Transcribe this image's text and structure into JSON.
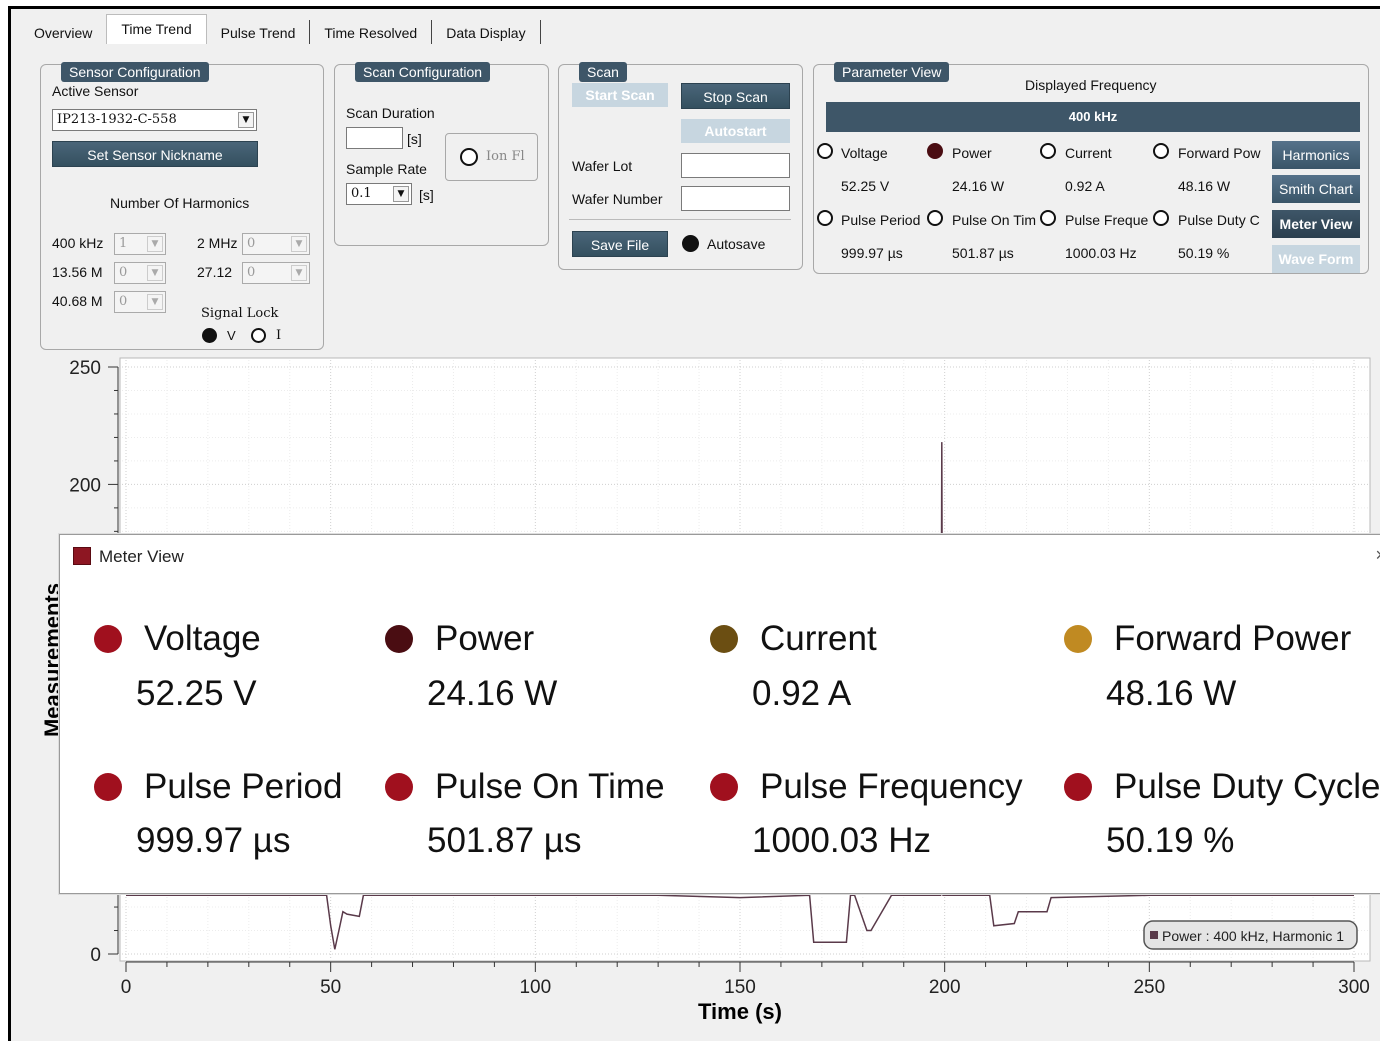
{
  "tabs": [
    "Overview",
    "Time Trend",
    "Pulse Trend",
    "Time Resolved",
    "Data Display"
  ],
  "sensor_config": {
    "title": "Sensor Configuration",
    "active_sensor_label": "Active Sensor",
    "active_sensor_value": "IP213-1932-C-558",
    "nickname_button": "Set Sensor Nickname",
    "harmonics_label": "Number Of Harmonics",
    "harmonics": [
      {
        "freq": "400 kHz",
        "value": "1"
      },
      {
        "freq": "2 MHz",
        "value": "0"
      },
      {
        "freq": "13.56 M",
        "value": "0"
      },
      {
        "freq": "27.12",
        "value": "0"
      },
      {
        "freq": "40.68 M",
        "value": "0"
      }
    ],
    "signal_lock_label": "Signal Lock",
    "signal_lock_v": "V",
    "signal_lock_i": "I"
  },
  "scan_config": {
    "title": "Scan Configuration",
    "duration_label": "Scan Duration",
    "duration_value": "",
    "unit_s": "[s]",
    "sample_rate_label": "Sample Rate",
    "sample_rate_value": "0.1",
    "ion_flux_label": "Ion Fl"
  },
  "scan": {
    "title": "Scan",
    "start_button": "Start Scan",
    "stop_button": "Stop Scan",
    "autostart_button": "Autostart",
    "wafer_lot_label": "Wafer Lot",
    "wafer_lot_value": "",
    "wafer_number_label": "Wafer Number",
    "wafer_number_value": "",
    "save_button": "Save File",
    "autosave_label": "Autosave"
  },
  "parameter_view": {
    "title": "Parameter View",
    "displayed_frequency_label": "Displayed Frequency",
    "displayed_frequency": "400 kHz",
    "params_row1": [
      {
        "name": "Voltage",
        "value": "52.25 V",
        "selected": false
      },
      {
        "name": "Power",
        "value": "24.16 W",
        "selected": true
      },
      {
        "name": "Current",
        "value": "0.92 A",
        "selected": false
      },
      {
        "name": "Forward Pow",
        "value": "48.16 W",
        "selected": false
      }
    ],
    "params_row2": [
      {
        "name": "Pulse Period",
        "value": "999.97 µs",
        "selected": false
      },
      {
        "name": "Pulse On Tim",
        "value": "501.87 µs",
        "selected": false
      },
      {
        "name": "Pulse Freque",
        "value": "1000.03 Hz",
        "selected": false
      },
      {
        "name": "Pulse Duty C",
        "value": "50.19 %",
        "selected": false
      }
    ],
    "buttons": [
      "Harmonics",
      "Smith Chart",
      "Meter View",
      "Wave Form"
    ]
  },
  "chart_data": {
    "type": "line",
    "xlabel": "Time (s)",
    "ylabel": "Measurements",
    "x_ticks": [
      "0",
      "50",
      "100",
      "150",
      "200",
      "250",
      "300"
    ],
    "y_ticks": [
      "0",
      "200",
      "250"
    ],
    "xlim": [
      0,
      300
    ],
    "ylim": [
      0,
      250
    ],
    "grid": true,
    "legend": "Power : 400 kHz, Harmonic 1",
    "series": [
      {
        "name": "Power : 400 kHz, Harmonic 1",
        "x": [
          0,
          49,
          50,
          51,
          52,
          53,
          54,
          57,
          58,
          130,
          150,
          167,
          168,
          176,
          177,
          178,
          181,
          182,
          187,
          188,
          193,
          195,
          196,
          197,
          198,
          199,
          199.3,
          199.6,
          200,
          211,
          212,
          217,
          218,
          225,
          226,
          250,
          280,
          300
        ],
        "y": [
          25,
          25,
          12,
          2,
          10,
          18,
          17,
          16,
          25,
          25,
          24,
          25,
          5,
          5,
          25,
          25,
          10,
          10,
          25,
          25,
          25,
          25,
          25,
          25,
          25,
          25,
          218,
          25,
          25,
          25,
          12,
          13,
          18,
          18,
          24,
          25,
          25,
          25
        ]
      }
    ]
  },
  "meter_view": {
    "title": "Meter View",
    "close": "×",
    "items": [
      {
        "name": "Voltage",
        "value": "52.25 V",
        "color": "#a0101e"
      },
      {
        "name": "Power",
        "value": "24.16 W",
        "color": "#4a0d12"
      },
      {
        "name": "Current",
        "value": "0.92 A",
        "color": "#6b4e12"
      },
      {
        "name": "Forward Power",
        "value": "48.16 W",
        "color": "#c08a22"
      },
      {
        "name": "Pulse Period",
        "value": "999.97 µs",
        "color": "#a0101e"
      },
      {
        "name": "Pulse On Time",
        "value": "501.87 µs",
        "color": "#a0101e"
      },
      {
        "name": "Pulse Frequency",
        "value": "1000.03 Hz",
        "color": "#a0101e"
      },
      {
        "name": "Pulse Duty Cycle",
        "value": "50.19 %",
        "color": "#a0101e"
      }
    ]
  }
}
